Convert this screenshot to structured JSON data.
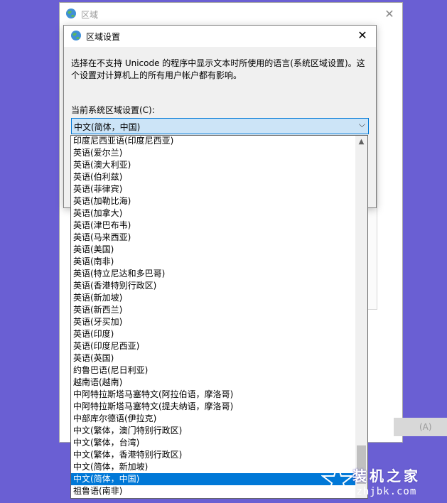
{
  "outer_window": {
    "title": "区域",
    "close": "✕",
    "apply_label": "(A)"
  },
  "dialog": {
    "title": "区域设置",
    "close": "✕",
    "description": "选择在不支持 Unicode 的程序中显示文本时所使用的语言(系统区域设置)。这个设置对计算机上的所有用户帐户都有影响。",
    "current_label": "当前系统区域设置(C):",
    "combo_value": "中文(简体，中国)",
    "combo_arrow": "⌵"
  },
  "dropdown": {
    "scroll_up": "▲",
    "selected_index": 28,
    "items": [
      "印度尼西亚语(印度尼西亚)",
      "英语(爱尔兰)",
      "英语(澳大利亚)",
      "英语(伯利兹)",
      "英语(菲律宾)",
      "英语(加勒比海)",
      "英语(加拿大)",
      "英语(津巴布韦)",
      "英语(马来西亚)",
      "英语(美国)",
      "英语(南非)",
      "英语(特立尼达和多巴哥)",
      "英语(香港特别行政区)",
      "英语(新加坡)",
      "英语(新西兰)",
      "英语(牙买加)",
      "英语(印度)",
      "英语(印度尼西亚)",
      "英语(英国)",
      "约鲁巴语(尼日利亚)",
      "越南语(越南)",
      "中阿特拉斯塔马塞特文(阿拉伯语，摩洛哥)",
      "中阿特拉斯塔马塞特文(提夫纳语，摩洛哥)",
      "中部库尔德语(伊拉克)",
      "中文(繁体，澳门特别行政区)",
      "中文(繁体，台湾)",
      "中文(繁体，香港特别行政区)",
      "中文(简体，新加坡)",
      "中文(简体，中国)",
      "祖鲁语(南非)"
    ]
  },
  "watermark": {
    "title": "装机之家",
    "url": "gzhjbk.com"
  },
  "colors": {
    "background": "#6a5fd3",
    "selection": "#0078d7",
    "combo_bg": "#cce4f7"
  }
}
